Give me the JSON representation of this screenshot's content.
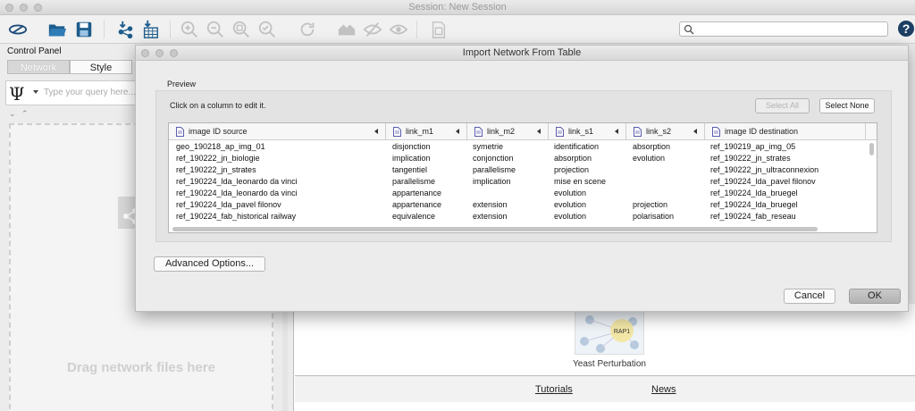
{
  "window": {
    "title": "Session: New Session"
  },
  "toolbar": {
    "icons": [
      "network-view-icon",
      "open-folder-icon",
      "save-icon",
      "import-network-icon",
      "import-table-icon",
      "zoom-in-icon",
      "zoom-out-icon",
      "zoom-fit-icon",
      "zoom-selected-icon",
      "refresh-icon",
      "home-icon",
      "hide-icon",
      "show-icon",
      "export-icon"
    ],
    "search_placeholder": "",
    "help_label": "?"
  },
  "control_panel": {
    "header": "Control Panel",
    "tabs": [
      {
        "label": "Network",
        "active": false
      },
      {
        "label": "Style",
        "active": true
      }
    ],
    "query_placeholder": "Type your query here...",
    "drop_text": "Drag network files here"
  },
  "welcome": {
    "sample_label": "Yeast Perturbation",
    "sample_node": "RAP1",
    "links": [
      "Tutorials",
      "News"
    ]
  },
  "dialog": {
    "title": "Import Network From Table",
    "preview_label": "Preview",
    "hint": "Click on a column to edit it.",
    "select_all": "Select All",
    "select_none": "Select None",
    "columns": [
      "image ID source",
      "link_m1",
      "link_m2",
      "link_s1",
      "link_s2",
      "image ID destination"
    ],
    "rows": [
      [
        "geo_190218_ap_img_01",
        "disjonction",
        "symetrie",
        "identification",
        "absorption",
        "ref_190219_ap_img_05"
      ],
      [
        "ref_190222_jn_biologie",
        "implication",
        "conjonction",
        "absorption",
        "evolution",
        "ref_190222_jn_strates"
      ],
      [
        "ref_190222_jn_strates",
        "tangentiel",
        "parallelisme",
        "projection",
        "",
        "ref_190222_jn_ultraconnexion"
      ],
      [
        "ref_190224_lda_leonardo da vinci",
        "parallelisme",
        "implication",
        "mise en scene",
        "",
        "ref_190224_lda_pavel filonov"
      ],
      [
        "ref_190224_lda_leonardo da vinci",
        "appartenance",
        "",
        "evolution",
        "",
        "ref_190224_lda_bruegel"
      ],
      [
        "ref_190224_lda_pavel filonov",
        "appartenance",
        "extension",
        "evolution",
        "projection",
        "ref_190224_lda_bruegel"
      ],
      [
        "ref_190224_fab_historical railway",
        "equivalence",
        "extension",
        "evolution",
        "polarisation",
        "ref_190224_fab_reseau"
      ]
    ],
    "advanced_options": "Advanced Options...",
    "cancel": "Cancel",
    "ok": "OK"
  }
}
